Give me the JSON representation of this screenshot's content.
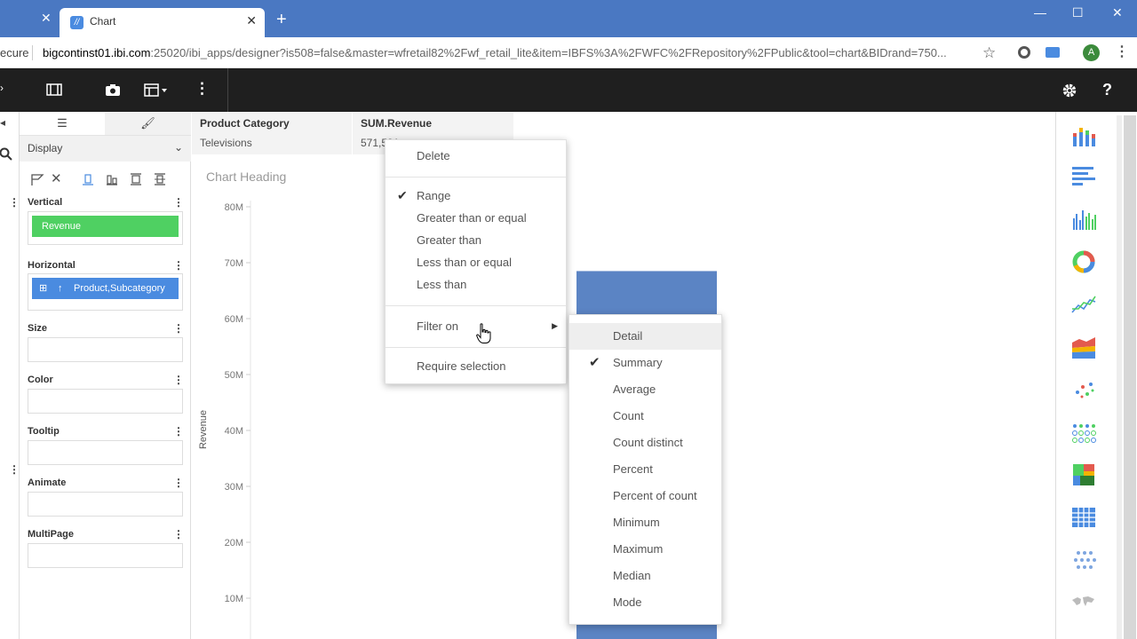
{
  "browser": {
    "prev_tab_close": "✕",
    "tab_title": "Chart",
    "tab_close": "✕",
    "new_tab": "+",
    "window_controls": [
      "—",
      "☐",
      "✕"
    ],
    "security_label": "ecure",
    "url_host": "bigcontinst01.ibi.com",
    "url_path": ":25020/ibi_apps/designer?is508=false&master=wfretail82%2Fwf_retail_lite&item=IBFS%3A%2FWFC%2FRepository%2FPublic&tool=chart&BIDrand=750...",
    "avatar_letter": "A"
  },
  "left_panel": {
    "display_label": "Display",
    "sections": [
      {
        "label": "Vertical"
      },
      {
        "label": "Horizontal"
      },
      {
        "label": "Size"
      },
      {
        "label": "Color"
      },
      {
        "label": "Tooltip"
      },
      {
        "label": "Animate"
      },
      {
        "label": "MultiPage"
      }
    ],
    "vertical_pill": "Revenue",
    "horizontal_pill": "Product,Subcategory"
  },
  "tooltip": {
    "header1": "Product Category",
    "value1": "Televisions",
    "header2": "SUM.Revenue",
    "value2": "571,591,..."
  },
  "chart": {
    "heading": "Chart Heading",
    "ylabel": "Revenue",
    "bar_color": "#5b84c4"
  },
  "chart_data": {
    "type": "bar",
    "title": "Chart Heading",
    "ylabel": "Revenue",
    "y_ticks": [
      "10M",
      "20M",
      "30M",
      "40M",
      "50M",
      "60M",
      "70M",
      "80M"
    ],
    "ylim": [
      0,
      80000000
    ],
    "series": [
      {
        "values": [
          68500000
        ]
      }
    ]
  },
  "context_menu": {
    "items": [
      {
        "label": "Delete",
        "checked": false
      },
      {
        "label": "Range",
        "checked": true
      },
      {
        "label": "Greater than or equal",
        "checked": false
      },
      {
        "label": "Greater than",
        "checked": false
      },
      {
        "label": "Less than or equal",
        "checked": false
      },
      {
        "label": "Less than",
        "checked": false
      },
      {
        "label": "Filter on",
        "checked": false
      },
      {
        "label": "Require selection",
        "checked": false
      }
    ],
    "check_glyph": "✔",
    "submenu_arrow": "▶"
  },
  "filter_submenu": {
    "items": [
      {
        "label": "Detail",
        "checked": false
      },
      {
        "label": "Summary",
        "checked": true
      },
      {
        "label": "Average",
        "checked": false
      },
      {
        "label": "Count",
        "checked": false
      },
      {
        "label": "Count distinct",
        "checked": false
      },
      {
        "label": "Percent",
        "checked": false
      },
      {
        "label": "Percent of count",
        "checked": false
      },
      {
        "label": "Minimum",
        "checked": false
      },
      {
        "label": "Maximum",
        "checked": false
      },
      {
        "label": "Median",
        "checked": false
      },
      {
        "label": "Mode",
        "checked": false
      }
    ]
  },
  "chart_type_icons": [
    "stacked-bar-chart-icon",
    "horizontal-bar-chart-icon",
    "grouped-bar-chart-icon",
    "donut-chart-icon",
    "line-chart-icon",
    "area-chart-icon",
    "scatter-chart-icon",
    "bubble-grid-icon",
    "treemap-icon",
    "table-grid-icon",
    "dot-matrix-icon",
    "world-map-icon"
  ]
}
